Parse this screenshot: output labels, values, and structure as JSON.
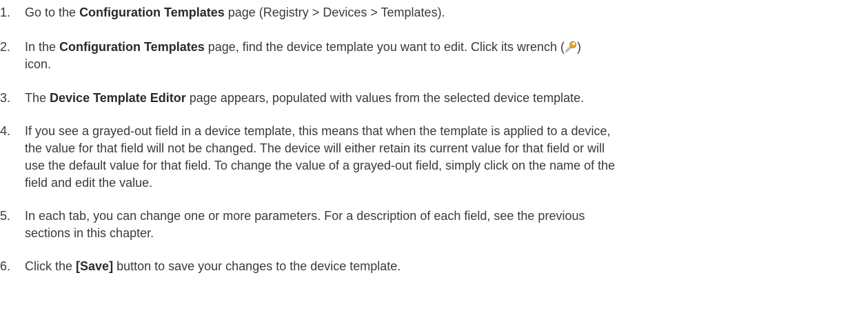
{
  "steps": [
    {
      "num": "1.",
      "pre": "Go to the ",
      "bold": "Configuration Templates",
      "post": " page (Registry > Devices > Templates)."
    },
    {
      "num": "2.",
      "pre": "In the ",
      "bold": "Configuration Templates",
      "post": " page, find the device template you want to edit. Click its wrench (",
      "icon": "wrench-icon",
      "post2": ")",
      "line2": "icon."
    },
    {
      "num": "3.",
      "pre": "The ",
      "bold": "Device Template Editor",
      "post": " page appears, populated with values from the selected device template."
    },
    {
      "num": "4.",
      "lines": [
        "If you see a grayed-out field in a device template, this means that when the template is applied to a device,",
        "the value for that field will not be changed. The device will either retain its current value for that field or will",
        "use the default value for that field. To change the value of a grayed-out field, simply click on the name of the",
        "field and edit the value."
      ]
    },
    {
      "num": "5.",
      "lines": [
        "In each tab, you can change one or more parameters. For a description of each field, see the previous",
        "sections in this chapter."
      ]
    },
    {
      "num": "6.",
      "pre": "Click the ",
      "bold": "[Save]",
      "post": " button to save your changes to the device template."
    }
  ],
  "colors": {
    "text": "#3a3a3a",
    "icon_wrench": "#e0a020"
  }
}
